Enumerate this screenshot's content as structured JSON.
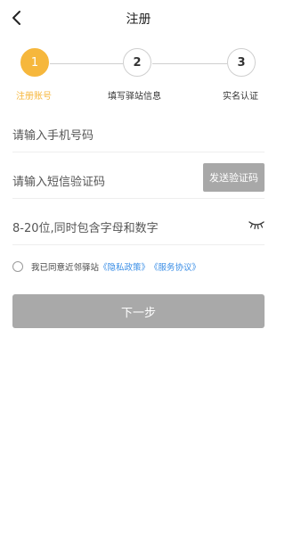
{
  "header": {
    "title": "注册"
  },
  "stepper": {
    "steps": [
      {
        "number": "1",
        "label": "注册账号",
        "active": true
      },
      {
        "number": "2",
        "label": "填写驿站信息",
        "active": false
      },
      {
        "number": "3",
        "label": "实名认证",
        "active": false
      }
    ]
  },
  "form": {
    "phone_placeholder": "请输入手机号码",
    "sms_placeholder": "请输入短信验证码",
    "send_code_label": "发送验证码",
    "password_placeholder": "8-20位,同时包含字母和数字"
  },
  "agreement": {
    "prefix": "我已同意近邻驿站",
    "privacy_link": "《隐私政策》",
    "service_link": "《服务协议》"
  },
  "next_button": "下一步",
  "colors": {
    "accent": "#f6b73c",
    "link": "#3a8ee6",
    "disabled_button": "#a9a9a9"
  },
  "icons": [
    "back-arrow-icon",
    "eye-closed-icon"
  ]
}
